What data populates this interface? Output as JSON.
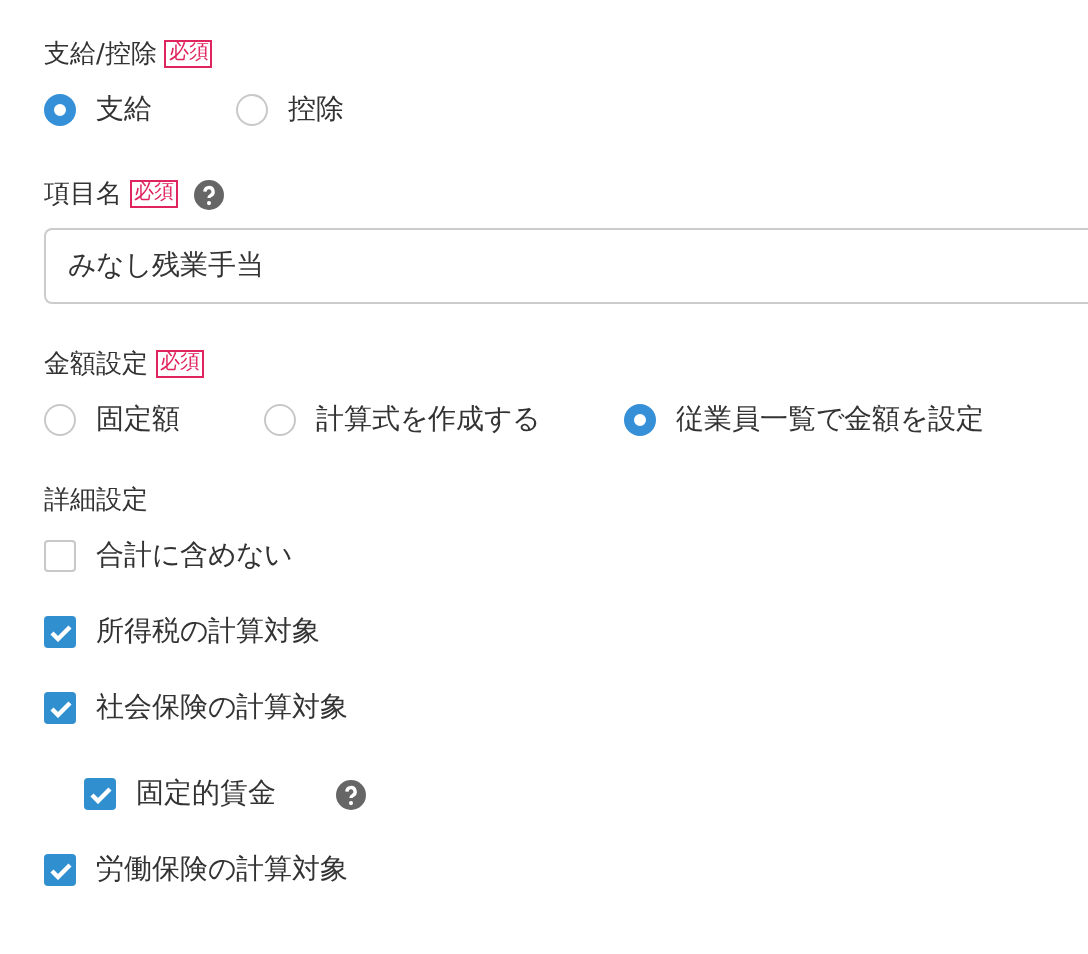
{
  "sections": [
    {
      "kind": "radio",
      "label": "支給/控除",
      "required": "必須",
      "help": false,
      "options": [
        {
          "label": "支給",
          "selected": true
        },
        {
          "label": "控除",
          "selected": false
        }
      ]
    },
    {
      "kind": "text",
      "label": "項目名",
      "required": "必須",
      "help": true,
      "value": "みなし残業手当"
    },
    {
      "kind": "radio",
      "label": "金額設定",
      "required": "必須",
      "help": false,
      "options": [
        {
          "label": "固定額",
          "selected": false
        },
        {
          "label": "計算式を作成する",
          "selected": false
        },
        {
          "label": "従業員一覧で金額を設定",
          "selected": true
        }
      ]
    },
    {
      "kind": "checks",
      "label": "詳細設定",
      "help": false,
      "items": [
        {
          "label": "合計に含めない",
          "checked": false,
          "help": false
        },
        {
          "label": "所得税の計算対象",
          "checked": true,
          "help": false
        },
        {
          "label": "社会保険の計算対象",
          "checked": true,
          "help": false,
          "children": [
            {
              "label": "固定的賃金",
              "checked": true,
              "help": true
            }
          ]
        },
        {
          "label": "労働保険の計算対象",
          "checked": true,
          "help": false
        }
      ]
    }
  ]
}
